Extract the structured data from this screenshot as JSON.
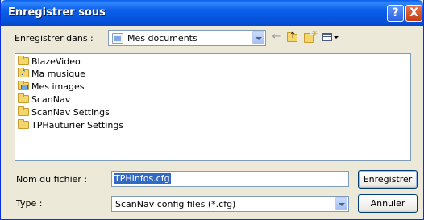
{
  "window": {
    "title": "Enregistrer sous",
    "help_glyph": "?",
    "close_glyph": "X"
  },
  "location": {
    "label": "Enregistrer dans :",
    "value": "Mes documents",
    "icon": "my-documents-icon"
  },
  "toolbar": {
    "back_icon": "back-arrow-icon",
    "up_icon": "up-folder-icon",
    "new_folder_icon": "new-folder-icon",
    "views_icon": "views-menu-icon"
  },
  "files": [
    {
      "name": "BlazeVideo",
      "icon": "folder-icon"
    },
    {
      "name": "Ma musique",
      "icon": "music-folder-icon"
    },
    {
      "name": "Mes images",
      "icon": "pictures-folder-icon"
    },
    {
      "name": "ScanNav",
      "icon": "folder-icon"
    },
    {
      "name": "ScanNav Settings",
      "icon": "folder-icon"
    },
    {
      "name": "TPHauturier Settings",
      "icon": "folder-icon"
    }
  ],
  "filename": {
    "label": "Nom du fichier :",
    "value": "TPHInfos.cfg"
  },
  "filetype": {
    "label": "Type :",
    "value": "ScanNav config files (*.cfg)"
  },
  "buttons": {
    "save": "Enregistrer",
    "cancel": "Annuler"
  },
  "colors": {
    "title_bar": "#0a5fe8",
    "selection": "#316ac5",
    "dialog_bg": "#ece9d8"
  }
}
